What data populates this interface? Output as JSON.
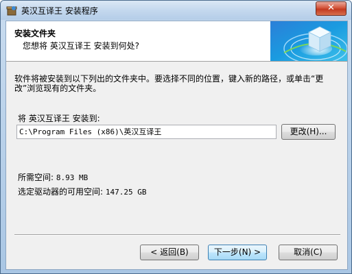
{
  "window": {
    "title": "英汉互译王 安装程序",
    "close_label": "✕"
  },
  "header": {
    "title": "安装文件夹",
    "subtitle": "您想将 英汉互译王 安装到何处?"
  },
  "body": {
    "description": "软件将被安装到以下列出的文件夹中。要选择不同的位置，键入新的路径，或单击“更改”浏览现有的文件夹。",
    "destination_label": "将 英汉互译王 安装到:",
    "destination_path": "C:\\Program Files (x86)\\英汉互译王",
    "change_button": "更改(H)...",
    "space_required_label": "所需空间:",
    "space_required_value": "8.93 MB",
    "space_available_label": "选定驱动器的可用空间:",
    "space_available_value": "147.25 GB"
  },
  "footer": {
    "back_button": "< 返回(B)",
    "next_button": "下一步(N) >",
    "cancel_button": "取消(C)"
  },
  "colors": {
    "accent": "#3c7fb1",
    "close": "#c23a20"
  }
}
